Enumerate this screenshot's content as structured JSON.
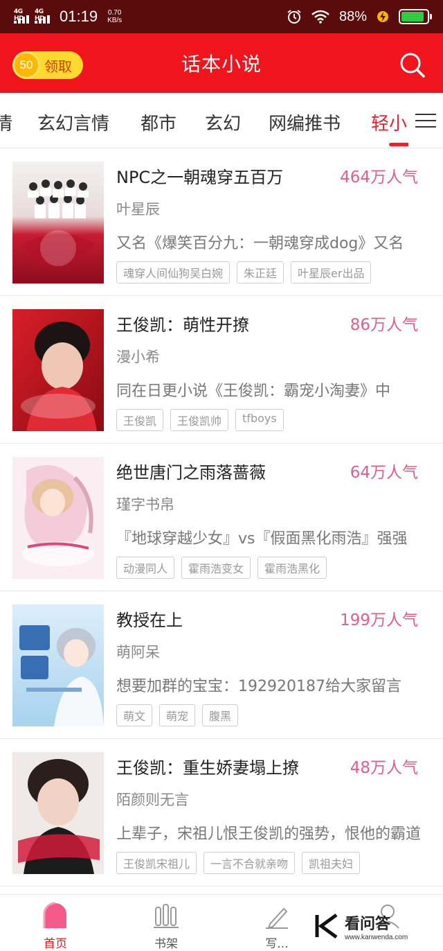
{
  "status_bar": {
    "signal1": "4G HD",
    "signal2": "4G HD",
    "time": "01:19",
    "speed_value": "0.70",
    "speed_unit": "KB/s",
    "battery_pct": "88%",
    "battery_level": 0.88,
    "battery_color": "#2ecc40"
  },
  "header": {
    "coin_count": "50",
    "coin_label": "领取",
    "title": "话本小说",
    "accent_color": "#f0141c"
  },
  "tabs": [
    {
      "label": "情"
    },
    {
      "label": "玄幻言情"
    },
    {
      "label": "都市"
    },
    {
      "label": "玄幻"
    },
    {
      "label": "网编推书"
    },
    {
      "label": "轻小"
    }
  ],
  "books": [
    {
      "title": "NPC之一朝魂穿五百万",
      "popularity": "464万人气",
      "author": "叶星辰",
      "description": "又名《爆笑百分九：一朝魂穿成dog》又名",
      "tags": [
        "魂穿人间仙狗吴白婉",
        "朱正廷",
        "叶星辰er出品"
      ]
    },
    {
      "title": "王俊凯：萌性开撩",
      "popularity": "86万人气",
      "author": "漫小希",
      "description": "同在日更小说《王俊凯：霸宠小淘妻》中",
      "tags": [
        "王俊凯",
        "王俊凯帅",
        "tfboys"
      ]
    },
    {
      "title": "绝世唐门之雨落蔷薇",
      "popularity": "64万人气",
      "author": "瑾字书帛",
      "description": "『地球穿越少女』vs『假面黑化雨浩』强强",
      "tags": [
        "动漫同人",
        "霍雨浩变女",
        "霍雨浩黑化"
      ]
    },
    {
      "title": "教授在上",
      "popularity": "199万人气",
      "author": "萌阿呆",
      "description": "想要加群的宝宝：192920187给大家留言",
      "tags": [
        "萌文",
        "萌宠",
        "腹黑"
      ]
    },
    {
      "title": "王俊凯：重生娇妻塌上撩",
      "popularity": "48万人气",
      "author": "陌颜则无言",
      "description": "上辈子，宋祖儿恨王俊凯的强势，恨他的霸道",
      "tags": [
        "王俊凯宋祖儿",
        "一言不合就亲吻",
        "凯祖夫妇"
      ]
    }
  ],
  "bottom_nav": [
    {
      "label": "首页",
      "icon": "home-icon",
      "active": true
    },
    {
      "label": "书架",
      "icon": "bookshelf-icon",
      "active": false
    },
    {
      "label": "写...",
      "icon": "pen-icon",
      "active": false
    },
    {
      "label": "",
      "icon": "profile-icon",
      "active": false
    }
  ],
  "watermark": {
    "text": "看问答",
    "url": "www.kanwenda.com"
  }
}
